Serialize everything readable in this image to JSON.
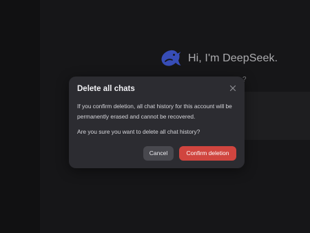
{
  "welcome": {
    "title": "Hi, I'm DeepSeek.",
    "logo_icon": "whale-logo-icon",
    "hint_text": "?"
  },
  "dialog": {
    "title": "Delete all chats",
    "close_icon": "close-icon",
    "body_text": "If you confirm deletion, all chat history for this account will be permanently erased and cannot be recovered.",
    "question_text": "Are you sure you want to delete all chat history?",
    "cancel_label": "Cancel",
    "confirm_label": "Confirm deletion"
  },
  "colors": {
    "accent": "#4d6bfe",
    "danger": "#d0453f",
    "dialog_bg": "#2c2c31"
  }
}
